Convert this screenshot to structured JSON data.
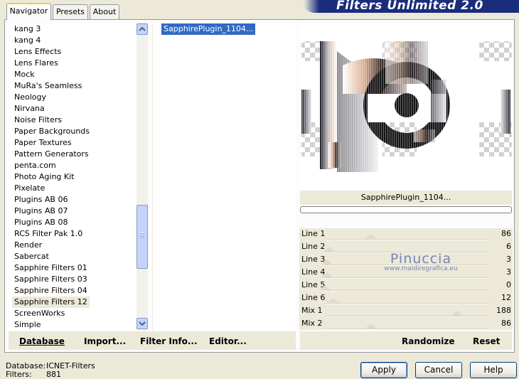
{
  "banner": {
    "title": "Filters Unlimited 2.0"
  },
  "tabs": [
    {
      "label": "Navigator",
      "active": true
    },
    {
      "label": "Presets",
      "active": false
    },
    {
      "label": "About",
      "active": false
    }
  ],
  "categories": {
    "items": [
      "kang 3",
      "kang 4",
      "Lens Effects",
      "Lens Flares",
      "Mock",
      "MuRa's Seamless",
      "Neology",
      "Nirvana",
      "Noise Filters",
      "Paper Backgrounds",
      "Paper Textures",
      "Pattern Generators",
      "penta.com",
      "Photo Aging Kit",
      "Pixelate",
      "Plugins AB 06",
      "Plugins AB 07",
      "Plugins AB 08",
      "RCS Filter Pak 1.0",
      "Render",
      "Sabercat",
      "Sapphire Filters 01",
      "Sapphire Filters 03",
      "Sapphire Filters 04",
      "Sapphire Filters 12",
      "ScreenWorks",
      "Simple"
    ],
    "selected": "Sapphire Filters 12"
  },
  "filters": {
    "items": [
      "SapphirePlugin_1104..."
    ],
    "selected": "SapphirePlugin_1104..."
  },
  "preview": {
    "name": "SapphirePlugin_1104...",
    "progress": 0
  },
  "sliders": [
    {
      "label": "Line 1",
      "value": "86"
    },
    {
      "label": "Line 2",
      "value": "6"
    },
    {
      "label": "Line 3",
      "value": "3"
    },
    {
      "label": "Line 4",
      "value": "3"
    },
    {
      "label": "Line 5",
      "value": "0"
    },
    {
      "label": "Line 6",
      "value": "12"
    },
    {
      "label": "Mix 1",
      "value": "188"
    },
    {
      "label": "Mix 2",
      "value": "86"
    }
  ],
  "watermark": {
    "name": "Pinuccia",
    "site": "www.maidiregrafica.eu"
  },
  "actions": {
    "database": "Database",
    "import": "Import...",
    "filter_info": "Filter Info...",
    "editor": "Editor...",
    "randomize": "Randomize",
    "reset": "Reset"
  },
  "status": {
    "database_label": "Database:",
    "database_value": "ICNET-Filters",
    "filters_label": "Filters:",
    "filters_value": "881"
  },
  "buttons": {
    "apply": "Apply",
    "cancel": "Cancel",
    "help": "Help"
  },
  "colors": {
    "selection": "#316ac5",
    "banner": "#1a2c7c",
    "tab_highlight": "#ffc83c"
  }
}
